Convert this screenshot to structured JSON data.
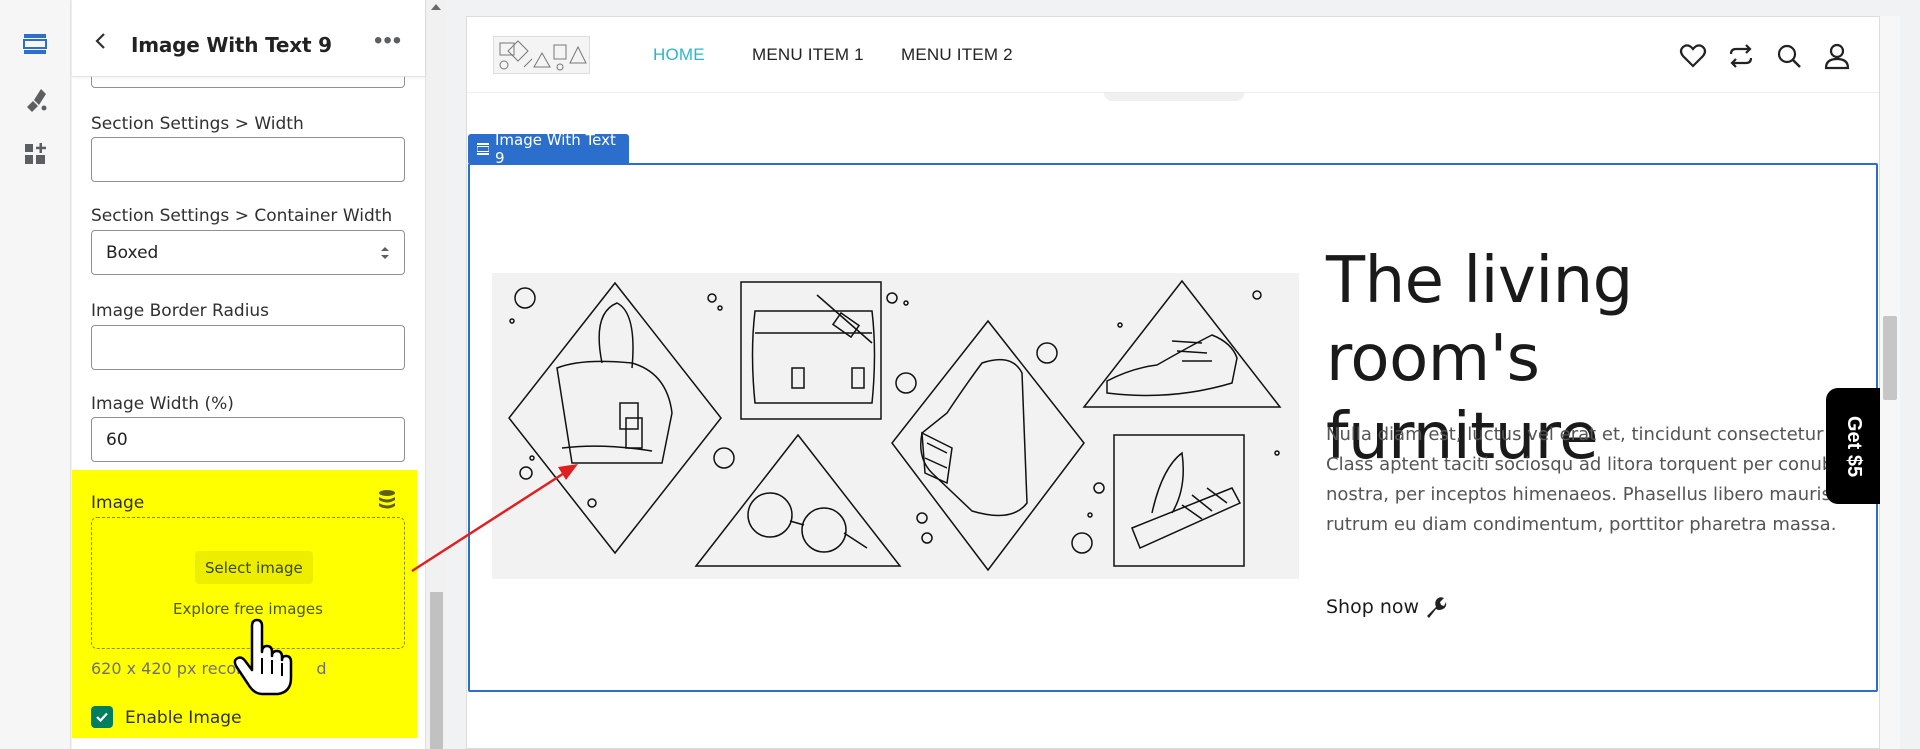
{
  "panel": {
    "title": "Image With Text 9",
    "fields": [
      {
        "label": "Section Settings > Width",
        "value": ""
      },
      {
        "label": "Section Settings > Container Width",
        "value": "Boxed"
      },
      {
        "label": "Image Border Radius",
        "value": ""
      },
      {
        "label": "Image Width (%)",
        "value": "60"
      }
    ],
    "image_block": {
      "label": "Image",
      "select_button": "Select image",
      "explore_link": "Explore free images",
      "recommendation": "620 x 420 px recomm",
      "recommendation_tail": "d",
      "enable_label": "Enable Image"
    }
  },
  "preview": {
    "nav": [
      {
        "label": "HOME",
        "color": "#2ab7c8"
      },
      {
        "label": "MENU ITEM 1",
        "color": "#222222"
      },
      {
        "label": "MENU ITEM 2",
        "color": "#222222"
      }
    ],
    "section_tag": "Image With Text 9",
    "hero": {
      "title_line1": "The living room's",
      "title_line2": "furniture",
      "body": [
        "Nulla diam est, luctus vel erat et, tincidunt consectetur justo.",
        "Class aptent taciti sociosqu ad litora torquent per conubia",
        "nostra, per inceptos himenaeos. Phasellus libero mauris,",
        "rutrum eu diam condimentum, porttitor pharetra massa."
      ],
      "cta": "Shop now"
    },
    "promo_tab": "Get $5"
  },
  "colors": {
    "accent": "#2c6ecb",
    "highlight": "#ffff00",
    "nav_active": "#2ab7c8",
    "check": "#007f5f"
  }
}
